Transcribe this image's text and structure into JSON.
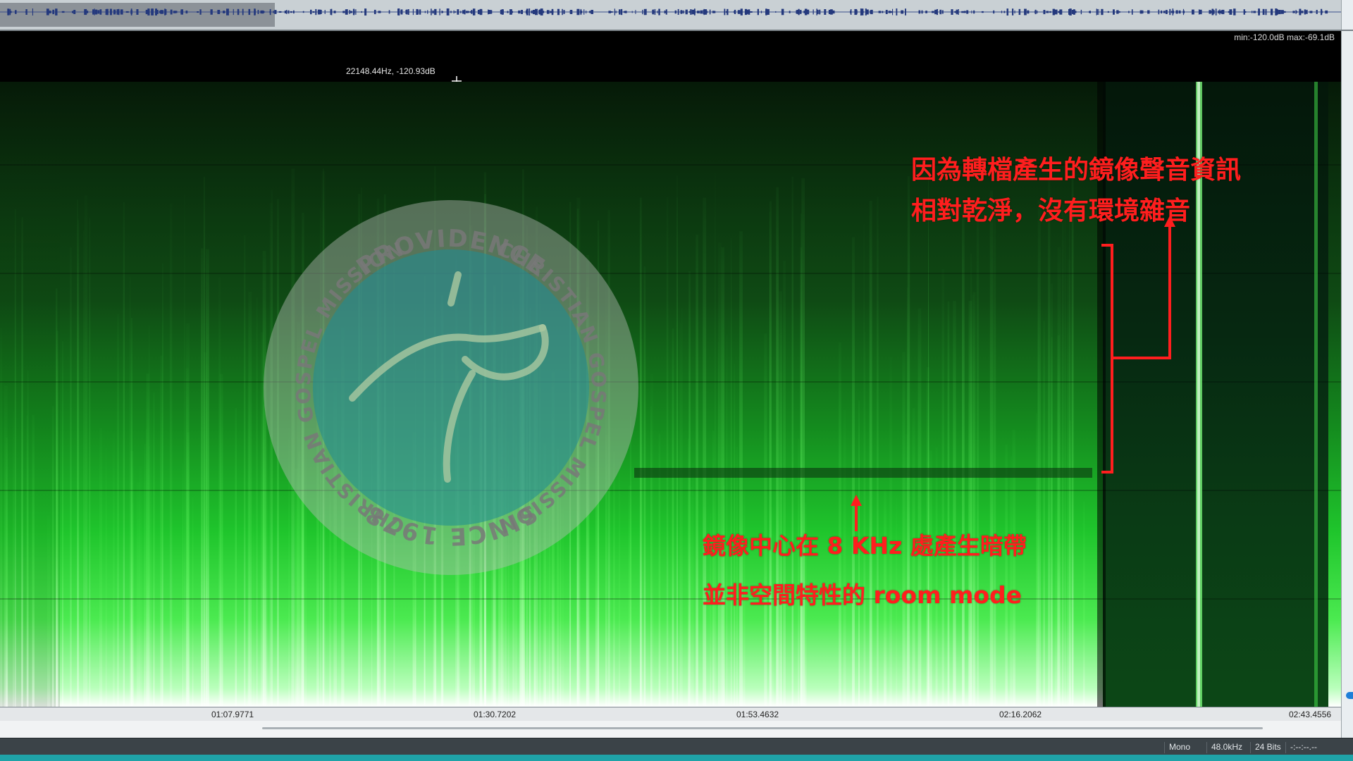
{
  "colors": {
    "annotation": "#ff1e1e",
    "spectrogram_base": "#1fc52c",
    "accent": "#1fa3a8",
    "status_bar": "#3b4348"
  },
  "header": {
    "range_readout": "min:-120.0dB max:-69.1dB",
    "cursor_readout": "22148.44Hz, -120.93dB",
    "cursor_icon": "crosshair-icon"
  },
  "watermark": {
    "top_text": "PROVIDENCE",
    "left_text": "CHRISTIAN GOSPEL MISSION",
    "right_text": "CHRISTIAN GOSPEL MISSION",
    "bottom_text": "SINCE 1978",
    "icon": "bird-emblem-icon"
  },
  "annotations": {
    "top_line1": "因為轉檔產生的鏡像聲音資訊",
    "top_line2": "相對乾淨，沒有環境雜音",
    "bottom_line1": "鏡像中心在 8 KHz 處產生暗帶",
    "bottom_line2": "並非空間特性的 room mode"
  },
  "timeline": {
    "ticks": [
      "01:07.9771",
      "01:30.7202",
      "01:53.4632",
      "02:16.2062",
      "02:43.4556"
    ]
  },
  "status": {
    "channels": "Mono",
    "sample_rate": "48.0kHz",
    "bit_depth": "24 Bits",
    "time": "-:--:--.--"
  }
}
